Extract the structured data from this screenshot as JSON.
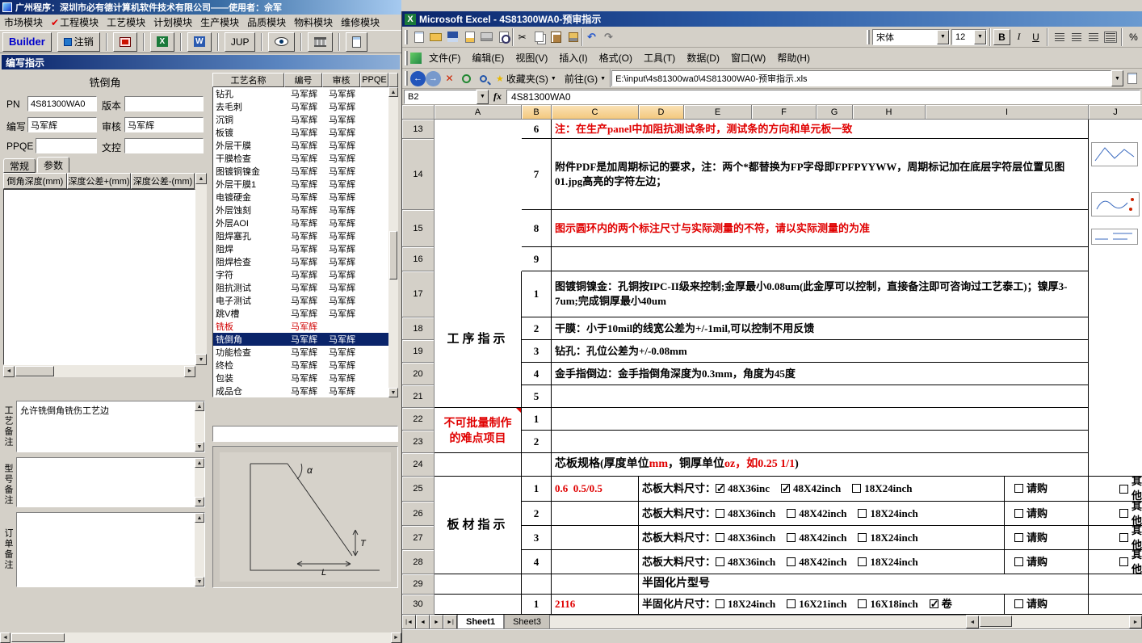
{
  "left_app": {
    "title_bar": {
      "title": "广州程序：深圳市必有德计算机软件技术有限公司——使用者：佘军"
    },
    "menu_items": [
      "市场模块",
      "工程模块",
      "工艺模块",
      "计划模块",
      "生产模块",
      "品质模块",
      "物料模块",
      "维修模块"
    ],
    "menu_check_index": 1,
    "toolbar": {
      "builder_label": "Builder",
      "logout_label": "注销",
      "jup_label": "JUP"
    },
    "panel": {
      "title": "编写指示",
      "process_label": "铣倒角",
      "fields": {
        "pn": {
          "label": "PN",
          "value": "4S81300WA0"
        },
        "version": {
          "label": "版本",
          "value": ""
        },
        "writer": {
          "label": "编写",
          "value": "马军辉"
        },
        "auditor": {
          "label": "审核",
          "value": "马军辉"
        },
        "ppqe": {
          "label": "PPQE",
          "value": ""
        },
        "doc_control": {
          "label": "文控",
          "value": ""
        }
      },
      "tabs": [
        "常规",
        "参数"
      ],
      "active_tab": "参数",
      "param_grid_headers": [
        "倒角深度(mm)",
        "深度公差+(mm)",
        "深度公差-(mm)"
      ],
      "notes": [
        {
          "label": "工艺备注",
          "value": "允许铣倒角铣伤工艺边"
        },
        {
          "label": "型号备注",
          "value": ""
        },
        {
          "label": "订单备注",
          "value": ""
        }
      ]
    },
    "process_table": {
      "headers": [
        "工艺名称",
        "编号",
        "审核",
        "PPQE"
      ],
      "rows": [
        {
          "name": "钻孔",
          "writer": "马军辉",
          "auditor": "马军辉",
          "ppqe": ""
        },
        {
          "name": "去毛刺",
          "writer": "马军辉",
          "auditor": "马军辉",
          "ppqe": ""
        },
        {
          "name": "沉铜",
          "writer": "马军辉",
          "auditor": "马军辉",
          "ppqe": ""
        },
        {
          "name": "板镀",
          "writer": "马军辉",
          "auditor": "马军辉",
          "ppqe": ""
        },
        {
          "name": "外层干膜",
          "writer": "马军辉",
          "auditor": "马军辉",
          "ppqe": ""
        },
        {
          "name": "干膜检查",
          "writer": "马军辉",
          "auditor": "马军辉",
          "ppqe": ""
        },
        {
          "name": "图镀铜镍金",
          "writer": "马军辉",
          "auditor": "马军辉",
          "ppqe": ""
        },
        {
          "name": "外层干膜1",
          "writer": "马军辉",
          "auditor": "马军辉",
          "ppqe": ""
        },
        {
          "name": "电镀硬金",
          "writer": "马军辉",
          "auditor": "马军辉",
          "ppqe": ""
        },
        {
          "name": "外层蚀刻",
          "writer": "马军辉",
          "auditor": "马军辉",
          "ppqe": ""
        },
        {
          "name": "外层AOI",
          "writer": "马军辉",
          "auditor": "马军辉",
          "ppqe": ""
        },
        {
          "name": "阻焊塞孔",
          "writer": "马军辉",
          "auditor": "马军辉",
          "ppqe": ""
        },
        {
          "name": "阻焊",
          "writer": "马军辉",
          "auditor": "马军辉",
          "ppqe": ""
        },
        {
          "name": "阻焊检查",
          "writer": "马军辉",
          "auditor": "马军辉",
          "ppqe": ""
        },
        {
          "name": "字符",
          "writer": "马军辉",
          "auditor": "马军辉",
          "ppqe": ""
        },
        {
          "name": "阻抗测试",
          "writer": "马军辉",
          "auditor": "马军辉",
          "ppqe": ""
        },
        {
          "name": "电子测试",
          "writer": "马军辉",
          "auditor": "马军辉",
          "ppqe": ""
        },
        {
          "name": "跳V槽",
          "writer": "马军辉",
          "auditor": "马军辉",
          "ppqe": ""
        },
        {
          "name": "铣板",
          "writer": "马军辉",
          "auditor": "",
          "ppqe": "",
          "red": 1
        },
        {
          "name": "铣倒角",
          "writer": "马军辉",
          "auditor": "马军辉",
          "ppqe": "",
          "sel": 1
        },
        {
          "name": "功能检查",
          "writer": "马军辉",
          "auditor": "马军辉",
          "ppqe": ""
        },
        {
          "name": "终检",
          "writer": "马军辉",
          "auditor": "马军辉",
          "ppqe": ""
        },
        {
          "name": "包装",
          "writer": "马军辉",
          "auditor": "马军辉",
          "ppqe": ""
        },
        {
          "name": "成品仓",
          "writer": "马军辉",
          "auditor": "马军辉",
          "ppqe": ""
        }
      ]
    },
    "diagram": {
      "angle": "α",
      "thickness": "T",
      "length": "L"
    }
  },
  "excel": {
    "title_bar": {
      "title": "Microsoft Excel - 4S81300WA0-预审指示"
    },
    "toolbar": {
      "font_name": "宋体",
      "font_size": "12",
      "bold": "B",
      "italic": "I",
      "underline": "U",
      "percent": "%"
    },
    "menu_items": [
      "文件(F)",
      "编辑(E)",
      "视图(V)",
      "插入(I)",
      "格式(O)",
      "工具(T)",
      "数据(D)",
      "窗口(W)",
      "帮助(H)"
    ],
    "web_toolbar": {
      "favorites_label": "收藏夹(S)",
      "go_label": "前往(G)",
      "address": "E:\\input\\4s81300wa0\\4S81300WA0-预审指示.xls"
    },
    "formula_bar": {
      "name_box": "B2",
      "fx_label": "fx",
      "formula": "4S81300WA0"
    },
    "column_headers": [
      "A",
      "B",
      "C",
      "D",
      "E",
      "F",
      "G",
      "H",
      "I",
      "J"
    ],
    "selected_columns": [
      "B",
      "C",
      "D"
    ],
    "sheet_tabs": [
      "Sheet1",
      "Sheet3"
    ],
    "active_sheet": "Sheet1",
    "grid_rows": [
      {
        "n": 13,
        "h": 24,
        "cells": [
          {
            "c": "B",
            "t": "6",
            "cls": "num"
          },
          {
            "c": "CI",
            "t": "注：在生产panel中加阻抗测试条时，测试条的方向和单元板一致",
            "cls": "red"
          }
        ]
      },
      {
        "n": 14,
        "h": 88,
        "cells": [
          {
            "c": "B",
            "t": "7",
            "cls": "num"
          },
          {
            "c": "CI",
            "t": "附件PDF是加周期标记的要求，注：两个*都替换为FP字母即FPFPYYWW，周期标记加在底层字符层位置见图01.jpg高亮的字符左边；"
          }
        ]
      },
      {
        "n": 15,
        "h": 46,
        "cells": [
          {
            "c": "B",
            "t": "8",
            "cls": "num"
          },
          {
            "c": "CI",
            "t": "图示圆环内的两个标注尺寸与实际测量的不符，请以实际测量的为准",
            "cls": "red"
          }
        ]
      },
      {
        "n": 16,
        "h": 30,
        "cells": [
          {
            "c": "B",
            "t": "9",
            "cls": "num"
          },
          {
            "c": "CI",
            "t": ""
          }
        ]
      },
      {
        "n": 17,
        "h": 57,
        "cells": [
          {
            "c": "A",
            "rs": 5,
            "t": "工序指示",
            "cls": "albl"
          },
          {
            "c": "B",
            "t": "1",
            "cls": "num"
          },
          {
            "c": "CI",
            "t": "图镀铜镍金：孔铜按IPC-II级来控制;金厚最小0.08um(此金厚可以控制，直接备注即可咨询过工艺泰工)；镍厚3-7um;完成铜厚最小40um"
          }
        ]
      },
      {
        "n": 18,
        "h": 28,
        "cells": [
          {
            "c": "B",
            "t": "2",
            "cls": "num"
          },
          {
            "c": "CI",
            "t": "干膜：小于10mil的线宽公差为+/-1mil,可以控制不用反馈"
          }
        ]
      },
      {
        "n": 19,
        "h": 28,
        "cells": [
          {
            "c": "B",
            "t": "3",
            "cls": "num"
          },
          {
            "c": "CI",
            "t": "钻孔：孔位公差为+/-0.08mm"
          }
        ]
      },
      {
        "n": 20,
        "h": 28,
        "cells": [
          {
            "c": "B",
            "t": "4",
            "cls": "num"
          },
          {
            "c": "CI",
            "t": "金手指倒边：金手指倒角深度为0.3mm，角度为45度"
          }
        ]
      },
      {
        "n": 21,
        "h": 28,
        "cells": [
          {
            "c": "B",
            "t": "5",
            "cls": "num"
          },
          {
            "c": "CI",
            "t": ""
          }
        ]
      },
      {
        "n": 22,
        "h": 28,
        "cells": [
          {
            "c": "A",
            "rs": 2,
            "t": "不可批量制作\n的难点项目",
            "cls": "dnp corner"
          },
          {
            "c": "B",
            "t": "1",
            "cls": "num"
          },
          {
            "c": "CI",
            "t": ""
          }
        ]
      },
      {
        "n": 23,
        "h": 28,
        "cells": [
          {
            "c": "B",
            "t": "2",
            "cls": "num"
          },
          {
            "c": "CI",
            "t": ""
          }
        ]
      },
      {
        "n": 24,
        "h": 29,
        "cells": [
          {
            "c": "A",
            "t": ""
          },
          {
            "c": "B",
            "t": "",
            "cls": "num"
          },
          {
            "c": "CI",
            "cls": "spec",
            "seg": [
              {
                "t": "芯板规格(厚度单位"
              },
              {
                "t": "mm",
                "r": 1
              },
              {
                "t": "，铜厚单位"
              },
              {
                "t": "oz，如0.25 1/1",
                "r": 1
              },
              {
                "t": ")"
              }
            ]
          },
          {
            "c": "K",
            "t": ""
          }
        ]
      },
      {
        "n": 25,
        "h": 31,
        "cells": [
          {
            "c": "A",
            "rs": 4,
            "t": "板材指示",
            "cls": "albl"
          },
          {
            "c": "B",
            "t": "1",
            "cls": "num"
          },
          {
            "c": "C",
            "t": "0.6  0.5/0.5",
            "cls": "red"
          },
          {
            "c": "D1",
            "cb": {
              "label": "芯板大料尺寸：",
              "items": [
                {
                  "t": "48X36inc",
                  "x": 1
                },
                {
                  "t": "48X42inch",
                  "x": 1
                },
                {
                  "t": "18X24inch",
                  "x": 0
                }
              ]
            }
          },
          {
            "c": "J",
            "cls": "qg",
            "cb": {
              "label": "",
              "items": [
                {
                  "t": "请购",
                  "x": 0
                }
              ]
            }
          },
          {
            "c": "K",
            "cls": "far",
            "cb": {
              "label": "",
              "items": [
                {
                  "t": "其他",
                  "x": 0
                }
              ]
            }
          }
        ]
      },
      {
        "n": 26,
        "h": 30,
        "cells": [
          {
            "c": "B",
            "t": "2",
            "cls": "num"
          },
          {
            "c": "C",
            "t": ""
          },
          {
            "c": "D1",
            "cb": {
              "label": "芯板大料尺寸：",
              "items": [
                {
                  "t": "48X36inch",
                  "x": 0
                },
                {
                  "t": "48X42inch",
                  "x": 0
                },
                {
                  "t": "18X24inch",
                  "x": 0
                }
              ]
            }
          },
          {
            "c": "J",
            "cls": "qg",
            "cb": {
              "label": "",
              "items": [
                {
                  "t": "请购",
                  "x": 0
                }
              ]
            }
          },
          {
            "c": "K",
            "cls": "far",
            "cb": {
              "label": "",
              "items": [
                {
                  "t": "其他",
                  "x": 0
                }
              ]
            }
          }
        ]
      },
      {
        "n": 27,
        "h": 30,
        "cells": [
          {
            "c": "B",
            "t": "3",
            "cls": "num"
          },
          {
            "c": "C",
            "t": ""
          },
          {
            "c": "D1",
            "cb": {
              "label": "芯板大料尺寸：",
              "items": [
                {
                  "t": "48X36inch",
                  "x": 0
                },
                {
                  "t": "48X42inch",
                  "x": 0
                },
                {
                  "t": "18X24inch",
                  "x": 0
                }
              ]
            }
          },
          {
            "c": "J",
            "cls": "qg",
            "cb": {
              "label": "",
              "items": [
                {
                  "t": "请购",
                  "x": 0
                }
              ]
            }
          },
          {
            "c": "K",
            "cls": "far",
            "cb": {
              "label": "",
              "items": [
                {
                  "t": "其他",
                  "x": 0
                }
              ]
            }
          }
        ]
      },
      {
        "n": 28,
        "h": 30,
        "cells": [
          {
            "c": "B",
            "t": "4",
            "cls": "num"
          },
          {
            "c": "C",
            "t": ""
          },
          {
            "c": "D1",
            "cb": {
              "label": "芯板大料尺寸：",
              "items": [
                {
                  "t": "48X36inch",
                  "x": 0
                },
                {
                  "t": "48X42inch",
                  "x": 0
                },
                {
                  "t": "18X24inch",
                  "x": 0
                }
              ]
            }
          },
          {
            "c": "J",
            "cls": "qg",
            "cb": {
              "label": "",
              "items": [
                {
                  "t": "请购",
                  "x": 0
                }
              ]
            }
          },
          {
            "c": "K",
            "cls": "far",
            "cb": {
              "label": "",
              "items": [
                {
                  "t": "其他",
                  "x": 0
                }
              ]
            }
          }
        ]
      },
      {
        "n": 29,
        "h": 25,
        "cells": [
          {
            "c": "A",
            "t": ""
          },
          {
            "c": "B",
            "t": "",
            "cls": "num"
          },
          {
            "c": "C",
            "t": ""
          },
          {
            "c": "DI",
            "t": "半固化片型号",
            "cls": "spec"
          },
          {
            "c": "K",
            "t": ""
          }
        ]
      },
      {
        "n": 30,
        "h": 25,
        "cells": [
          {
            "c": "A",
            "t": ""
          },
          {
            "c": "B",
            "t": "1",
            "cls": "num"
          },
          {
            "c": "C",
            "t": "2116",
            "cls": "red"
          },
          {
            "c": "D1",
            "cb": {
              "label": "半固化片尺寸：",
              "items": [
                {
                  "t": "18X24inch",
                  "x": 0
                },
                {
                  "t": "16X21inch",
                  "x": 0
                },
                {
                  "t": "16X18inch",
                  "x": 0
                },
                {
                  "t": "卷",
                  "x": 1
                }
              ]
            }
          },
          {
            "c": "J",
            "cls": "qg",
            "cb": {
              "label": "",
              "items": [
                {
                  "t": "请购",
                  "x": 0
                }
              ]
            }
          },
          {
            "c": "K",
            "t": ""
          }
        ]
      }
    ]
  }
}
